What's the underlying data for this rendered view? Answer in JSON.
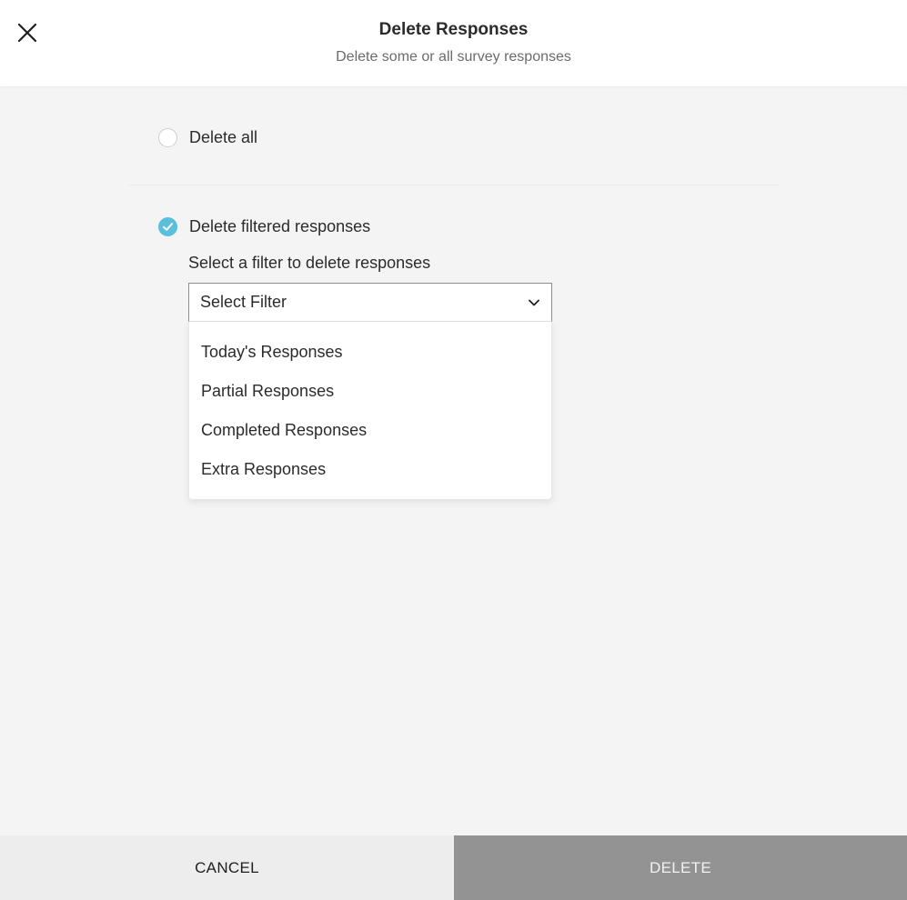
{
  "header": {
    "title": "Delete Responses",
    "subtitle": "Delete some or all survey responses",
    "close_icon": "close-icon"
  },
  "options": [
    {
      "label": "Delete all",
      "selected": false
    },
    {
      "label": "Delete filtered responses",
      "selected": true
    }
  ],
  "filter": {
    "label": "Select a filter to delete responses",
    "selected_value": "Select Filter",
    "items": [
      "Today's Responses",
      "Partial Responses",
      "Completed Responses",
      "Extra Responses"
    ]
  },
  "footer": {
    "cancel_label": "CANCEL",
    "delete_label": "DELETE"
  },
  "colors": {
    "accent": "#5bbfdc",
    "delete_button": "#939393",
    "cancel_button": "#ededed",
    "background": "#f4f4f4"
  }
}
